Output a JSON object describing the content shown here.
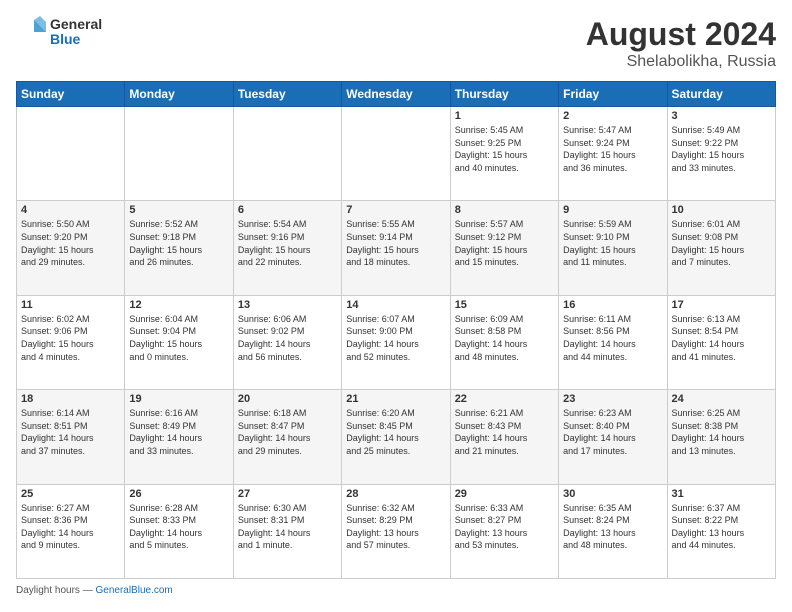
{
  "header": {
    "logo_line1": "General",
    "logo_line2": "Blue",
    "month_year": "August 2024",
    "location": "Shelabolikha, Russia"
  },
  "weekdays": [
    "Sunday",
    "Monday",
    "Tuesday",
    "Wednesday",
    "Thursday",
    "Friday",
    "Saturday"
  ],
  "weeks": [
    [
      {
        "day": "",
        "info": ""
      },
      {
        "day": "",
        "info": ""
      },
      {
        "day": "",
        "info": ""
      },
      {
        "day": "",
        "info": ""
      },
      {
        "day": "1",
        "info": "Sunrise: 5:45 AM\nSunset: 9:25 PM\nDaylight: 15 hours\nand 40 minutes."
      },
      {
        "day": "2",
        "info": "Sunrise: 5:47 AM\nSunset: 9:24 PM\nDaylight: 15 hours\nand 36 minutes."
      },
      {
        "day": "3",
        "info": "Sunrise: 5:49 AM\nSunset: 9:22 PM\nDaylight: 15 hours\nand 33 minutes."
      }
    ],
    [
      {
        "day": "4",
        "info": "Sunrise: 5:50 AM\nSunset: 9:20 PM\nDaylight: 15 hours\nand 29 minutes."
      },
      {
        "day": "5",
        "info": "Sunrise: 5:52 AM\nSunset: 9:18 PM\nDaylight: 15 hours\nand 26 minutes."
      },
      {
        "day": "6",
        "info": "Sunrise: 5:54 AM\nSunset: 9:16 PM\nDaylight: 15 hours\nand 22 minutes."
      },
      {
        "day": "7",
        "info": "Sunrise: 5:55 AM\nSunset: 9:14 PM\nDaylight: 15 hours\nand 18 minutes."
      },
      {
        "day": "8",
        "info": "Sunrise: 5:57 AM\nSunset: 9:12 PM\nDaylight: 15 hours\nand 15 minutes."
      },
      {
        "day": "9",
        "info": "Sunrise: 5:59 AM\nSunset: 9:10 PM\nDaylight: 15 hours\nand 11 minutes."
      },
      {
        "day": "10",
        "info": "Sunrise: 6:01 AM\nSunset: 9:08 PM\nDaylight: 15 hours\nand 7 minutes."
      }
    ],
    [
      {
        "day": "11",
        "info": "Sunrise: 6:02 AM\nSunset: 9:06 PM\nDaylight: 15 hours\nand 4 minutes."
      },
      {
        "day": "12",
        "info": "Sunrise: 6:04 AM\nSunset: 9:04 PM\nDaylight: 15 hours\nand 0 minutes."
      },
      {
        "day": "13",
        "info": "Sunrise: 6:06 AM\nSunset: 9:02 PM\nDaylight: 14 hours\nand 56 minutes."
      },
      {
        "day": "14",
        "info": "Sunrise: 6:07 AM\nSunset: 9:00 PM\nDaylight: 14 hours\nand 52 minutes."
      },
      {
        "day": "15",
        "info": "Sunrise: 6:09 AM\nSunset: 8:58 PM\nDaylight: 14 hours\nand 48 minutes."
      },
      {
        "day": "16",
        "info": "Sunrise: 6:11 AM\nSunset: 8:56 PM\nDaylight: 14 hours\nand 44 minutes."
      },
      {
        "day": "17",
        "info": "Sunrise: 6:13 AM\nSunset: 8:54 PM\nDaylight: 14 hours\nand 41 minutes."
      }
    ],
    [
      {
        "day": "18",
        "info": "Sunrise: 6:14 AM\nSunset: 8:51 PM\nDaylight: 14 hours\nand 37 minutes."
      },
      {
        "day": "19",
        "info": "Sunrise: 6:16 AM\nSunset: 8:49 PM\nDaylight: 14 hours\nand 33 minutes."
      },
      {
        "day": "20",
        "info": "Sunrise: 6:18 AM\nSunset: 8:47 PM\nDaylight: 14 hours\nand 29 minutes."
      },
      {
        "day": "21",
        "info": "Sunrise: 6:20 AM\nSunset: 8:45 PM\nDaylight: 14 hours\nand 25 minutes."
      },
      {
        "day": "22",
        "info": "Sunrise: 6:21 AM\nSunset: 8:43 PM\nDaylight: 14 hours\nand 21 minutes."
      },
      {
        "day": "23",
        "info": "Sunrise: 6:23 AM\nSunset: 8:40 PM\nDaylight: 14 hours\nand 17 minutes."
      },
      {
        "day": "24",
        "info": "Sunrise: 6:25 AM\nSunset: 8:38 PM\nDaylight: 14 hours\nand 13 minutes."
      }
    ],
    [
      {
        "day": "25",
        "info": "Sunrise: 6:27 AM\nSunset: 8:36 PM\nDaylight: 14 hours\nand 9 minutes."
      },
      {
        "day": "26",
        "info": "Sunrise: 6:28 AM\nSunset: 8:33 PM\nDaylight: 14 hours\nand 5 minutes."
      },
      {
        "day": "27",
        "info": "Sunrise: 6:30 AM\nSunset: 8:31 PM\nDaylight: 14 hours\nand 1 minute."
      },
      {
        "day": "28",
        "info": "Sunrise: 6:32 AM\nSunset: 8:29 PM\nDaylight: 13 hours\nand 57 minutes."
      },
      {
        "day": "29",
        "info": "Sunrise: 6:33 AM\nSunset: 8:27 PM\nDaylight: 13 hours\nand 53 minutes."
      },
      {
        "day": "30",
        "info": "Sunrise: 6:35 AM\nSunset: 8:24 PM\nDaylight: 13 hours\nand 48 minutes."
      },
      {
        "day": "31",
        "info": "Sunrise: 6:37 AM\nSunset: 8:22 PM\nDaylight: 13 hours\nand 44 minutes."
      }
    ]
  ],
  "footer": {
    "note": "Daylight hours",
    "source": "GeneralBlue.com"
  }
}
